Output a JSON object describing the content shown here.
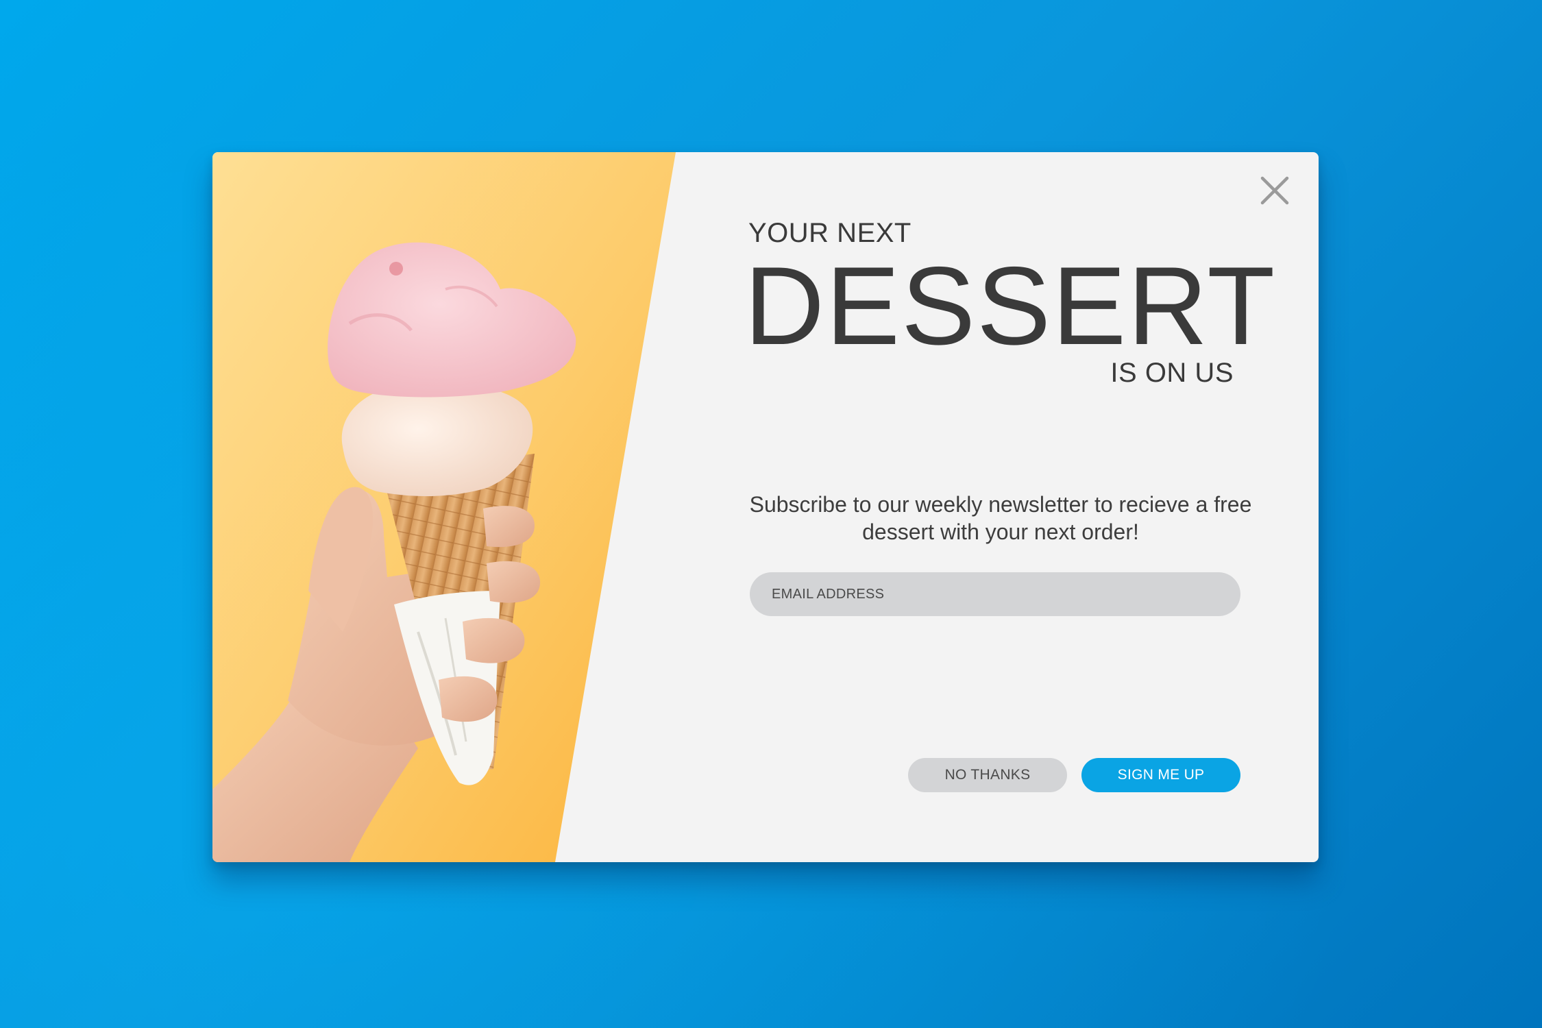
{
  "popup": {
    "headline_top": "YOUR NEXT",
    "headline_main": "DESSERT",
    "headline_bottom": "IS ON US",
    "subtitle": "Subscribe to our weekly newsletter to recieve a free dessert with your next order!",
    "email_placeholder": "EMAIL ADDRESS",
    "email_value": "",
    "decline_label": "NO THANKS",
    "accept_label": "SIGN ME UP",
    "close_icon": "close-icon",
    "image": "ice-cream-cone-photo"
  },
  "colors": {
    "background_start": "#00a8ec",
    "background_end": "#0074bd",
    "modal_background": "#f3f3f3",
    "image_background": "#fcc25a",
    "primary_button": "#0aa4e4",
    "secondary_button": "#d3d4d6",
    "headline_text": "#3a3a3a"
  }
}
